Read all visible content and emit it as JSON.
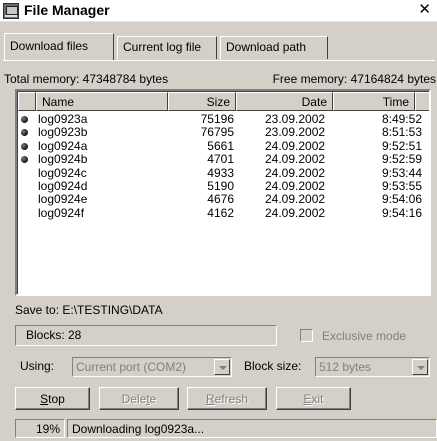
{
  "window": {
    "title": "File Manager",
    "close_glyph": "✕",
    "icon": "file-manager-app-icon"
  },
  "tabs": [
    {
      "label": "Download files",
      "active": true
    },
    {
      "label": "Current log file",
      "active": false
    },
    {
      "label": "Download path",
      "active": false
    }
  ],
  "memory": {
    "total": "Total memory: 47348784 bytes",
    "free": "Free memory: 47164824 bytes"
  },
  "files": {
    "columns": [
      "Name",
      "Size",
      "Date",
      "Time"
    ],
    "rows": [
      {
        "marked": true,
        "name": "log0923a",
        "size": "75196",
        "date": "23.09.2002",
        "time": "8:49:52"
      },
      {
        "marked": true,
        "name": "log0923b",
        "size": "76795",
        "date": "23.09.2002",
        "time": "8:51:53"
      },
      {
        "marked": true,
        "name": "log0924a",
        "size": "5661",
        "date": "24.09.2002",
        "time": "9:52:51"
      },
      {
        "marked": true,
        "name": "log0924b",
        "size": "4701",
        "date": "24.09.2002",
        "time": "9:52:59"
      },
      {
        "marked": false,
        "name": "log0924c",
        "size": "4933",
        "date": "24.09.2002",
        "time": "9:53:44"
      },
      {
        "marked": false,
        "name": "log0924d",
        "size": "5190",
        "date": "24.09.2002",
        "time": "9:53:55"
      },
      {
        "marked": false,
        "name": "log0924e",
        "size": "4676",
        "date": "24.09.2002",
        "time": "9:54:06"
      },
      {
        "marked": false,
        "name": "log0924f",
        "size": "4162",
        "date": "24.09.2002",
        "time": "9:54:16"
      }
    ]
  },
  "save_to": "Save to: E:\\TESTING\\DATA",
  "blocks": "Blocks: 28",
  "exclusive_mode": {
    "label": "Exclusive mode",
    "checked": false
  },
  "using": {
    "label": "Using:",
    "value": "Current port (COM2)"
  },
  "block_size": {
    "label": "Block size:",
    "value": "512 bytes"
  },
  "buttons": {
    "stop": {
      "label": "Stop",
      "hotkey": "S"
    },
    "delete": {
      "label": "Delete",
      "hotkey": "t"
    },
    "refresh": {
      "label": "Refresh",
      "hotkey": "R"
    },
    "exit": {
      "label": "Exit",
      "hotkey": "E"
    }
  },
  "status": {
    "progress": "19%",
    "message": "Downloading log0923a..."
  },
  "colors": {
    "face": "#d4d0c8",
    "disabled_text": "#808080"
  }
}
